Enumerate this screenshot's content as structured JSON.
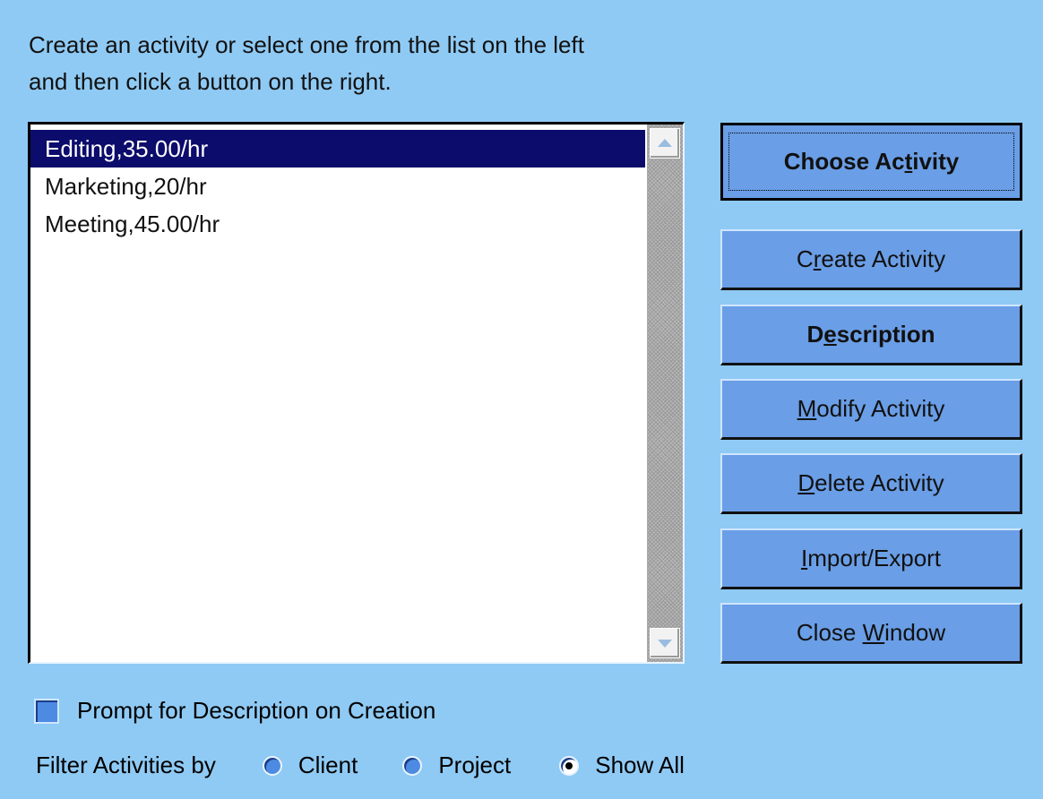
{
  "instructions": {
    "line1": "Create an activity or select one from the list on the left",
    "line2": "and then click a button on the right."
  },
  "activities": [
    {
      "label": "Editing,35.00/hr",
      "selected": true
    },
    {
      "label": "Marketing,20/hr",
      "selected": false
    },
    {
      "label": "Meeting,45.00/hr",
      "selected": false
    }
  ],
  "buttons": {
    "choose": {
      "pre": "Choose Ac",
      "key": "t",
      "post": "ivity"
    },
    "create": {
      "pre": "C",
      "key": "r",
      "post": "eate Activity"
    },
    "description": {
      "pre": "D",
      "key": "e",
      "post": "scription"
    },
    "modify": {
      "pre": "",
      "key": "M",
      "post": "odify Activity"
    },
    "delete": {
      "pre": "",
      "key": "D",
      "post": "elete Activity"
    },
    "import_export": {
      "pre": "",
      "key": "I",
      "post": "mport/Export"
    },
    "close": {
      "pre": "Close ",
      "key": "W",
      "post": "indow"
    }
  },
  "prompt_checkbox": {
    "label": "Prompt for Description on Creation",
    "checked": false
  },
  "filter": {
    "label": "Filter Activities by",
    "options": [
      {
        "label": "Client",
        "selected": false
      },
      {
        "label": "Project",
        "selected": false
      },
      {
        "label": "Show All",
        "selected": true
      }
    ]
  },
  "colors": {
    "background": "#8fcaf4",
    "button": "#6a9ee6",
    "selection": "#0c0c6c"
  }
}
